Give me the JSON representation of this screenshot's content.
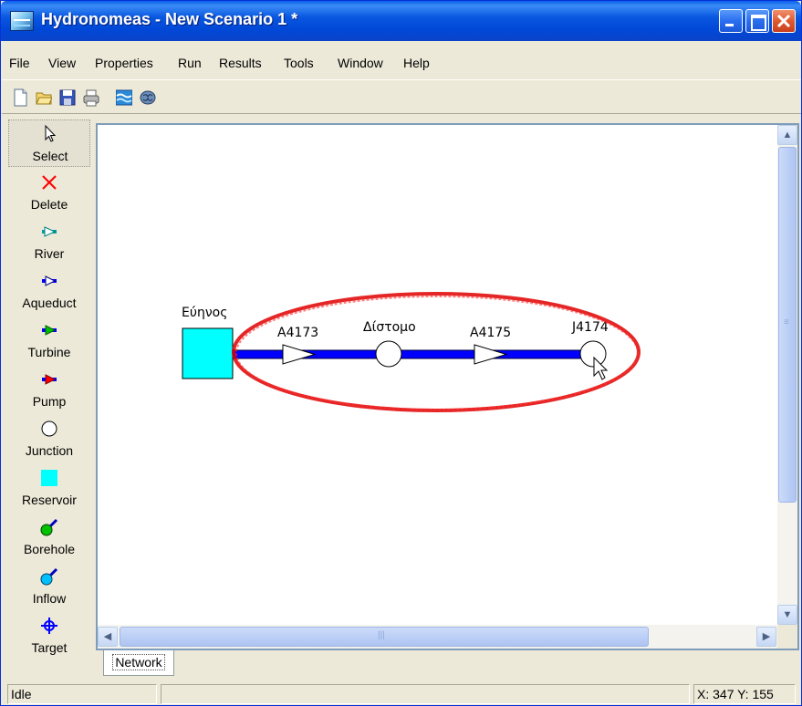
{
  "window": {
    "title": "Hydronomeas - New Scenario 1 *"
  },
  "menubar": {
    "items": [
      "File",
      "View",
      "Properties",
      "Run",
      "Results",
      "Tools",
      "Window",
      "Help"
    ]
  },
  "toolbar": {
    "buttons": [
      "new-file-icon",
      "open-folder-icon",
      "save-disk-icon",
      "print-icon",
      "run-water-icon",
      "brain-icon"
    ]
  },
  "palette": {
    "items": [
      {
        "label": "Select",
        "icon": "arrow-cursor-icon",
        "selected": true
      },
      {
        "label": "Delete",
        "icon": "red-x-icon",
        "color": "#ff0000"
      },
      {
        "label": "River",
        "icon": "river-link-icon",
        "color": "#00a0a0"
      },
      {
        "label": "Aqueduct",
        "icon": "aqueduct-link-icon",
        "color": "#0000ff"
      },
      {
        "label": "Turbine",
        "icon": "turbine-link-icon",
        "color": "#00c000"
      },
      {
        "label": "Pump",
        "icon": "pump-link-icon",
        "color": "#ff0000"
      },
      {
        "label": "Junction",
        "icon": "junction-circle-icon",
        "color": "#ffffff"
      },
      {
        "label": "Reservoir",
        "icon": "reservoir-square-icon",
        "color": "#00ffff"
      },
      {
        "label": "Borehole",
        "icon": "borehole-icon",
        "color": "#00c000"
      },
      {
        "label": "Inflow",
        "icon": "inflow-icon",
        "color": "#00c0ff"
      },
      {
        "label": "Target",
        "icon": "target-crosshair-icon",
        "color": "#0000ff"
      }
    ]
  },
  "network": {
    "reservoir": {
      "label": "Εύηνος",
      "color": "#00ffff"
    },
    "link_color": "#0000ff",
    "highlight_color": "#e00000",
    "nodes": [
      {
        "label": "A4173",
        "kind": "aqueduct"
      },
      {
        "label": "Δίστομο",
        "kind": "junction"
      },
      {
        "label": "A4175",
        "kind": "aqueduct"
      },
      {
        "label": "J4174",
        "kind": "junction"
      }
    ]
  },
  "tabs": {
    "active": "Network"
  },
  "statusbar": {
    "state": "Idle",
    "coords": "X: 347 Y: 155"
  }
}
